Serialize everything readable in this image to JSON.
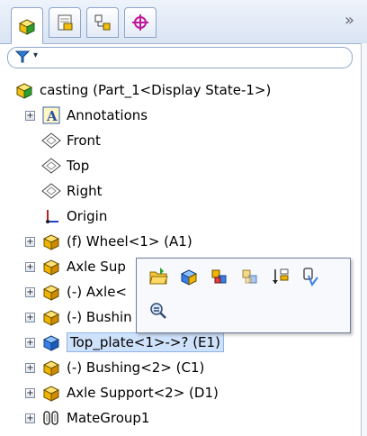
{
  "tabs": [
    {
      "name": "featuremanager-tab-icon",
      "active": true
    },
    {
      "name": "propertymanager-tab-icon",
      "active": false
    },
    {
      "name": "configurationmanager-tab-icon",
      "active": false
    },
    {
      "name": "dimxpert-tab-icon",
      "active": false
    }
  ],
  "tabstrip": {
    "more_label": "»"
  },
  "filter": {
    "dropdown_glyph": "▾"
  },
  "tree": {
    "root_label": "casting  (Part_1<Display State-1>)",
    "items": [
      {
        "label": "Annotations",
        "icon": "annotations-icon",
        "expandable": true
      },
      {
        "label": "Front",
        "icon": "plane-icon",
        "expandable": false
      },
      {
        "label": "Top",
        "icon": "plane-icon",
        "expandable": false
      },
      {
        "label": "Right",
        "icon": "plane-icon",
        "expandable": false
      },
      {
        "label": "Origin",
        "icon": "origin-icon",
        "expandable": false
      },
      {
        "label": "(f) Wheel<1> (A1)",
        "icon": "part-icon",
        "expandable": true
      },
      {
        "label": "Axle Sup",
        "icon": "part-icon",
        "expandable": true
      },
      {
        "label": "(-) Axle<",
        "icon": "part-icon",
        "expandable": true
      },
      {
        "label": "(-) Bushin",
        "icon": "part-icon",
        "expandable": true
      },
      {
        "label": "Top_plate<1>->? (E1)",
        "icon": "part-selected-icon",
        "expandable": true,
        "selected": true
      },
      {
        "label": "(-) Bushing<2> (C1)",
        "icon": "part-icon",
        "expandable": true
      },
      {
        "label": "Axle Support<2> (D1)",
        "icon": "part-icon",
        "expandable": true
      },
      {
        "label": "MateGroup1",
        "icon": "mates-icon",
        "expandable": true
      }
    ]
  },
  "popup": {
    "buttons": [
      "open-part-icon",
      "edit-part-icon",
      "hide-components-icon",
      "change-transparency-icon",
      "isolate-icon",
      "component-properties-icon",
      "zoom-to-selection-icon"
    ]
  },
  "colors": {
    "accent": "#1f5fbf",
    "part_yellow": "#e0a800",
    "selected_bg": "#cfe2fb"
  }
}
